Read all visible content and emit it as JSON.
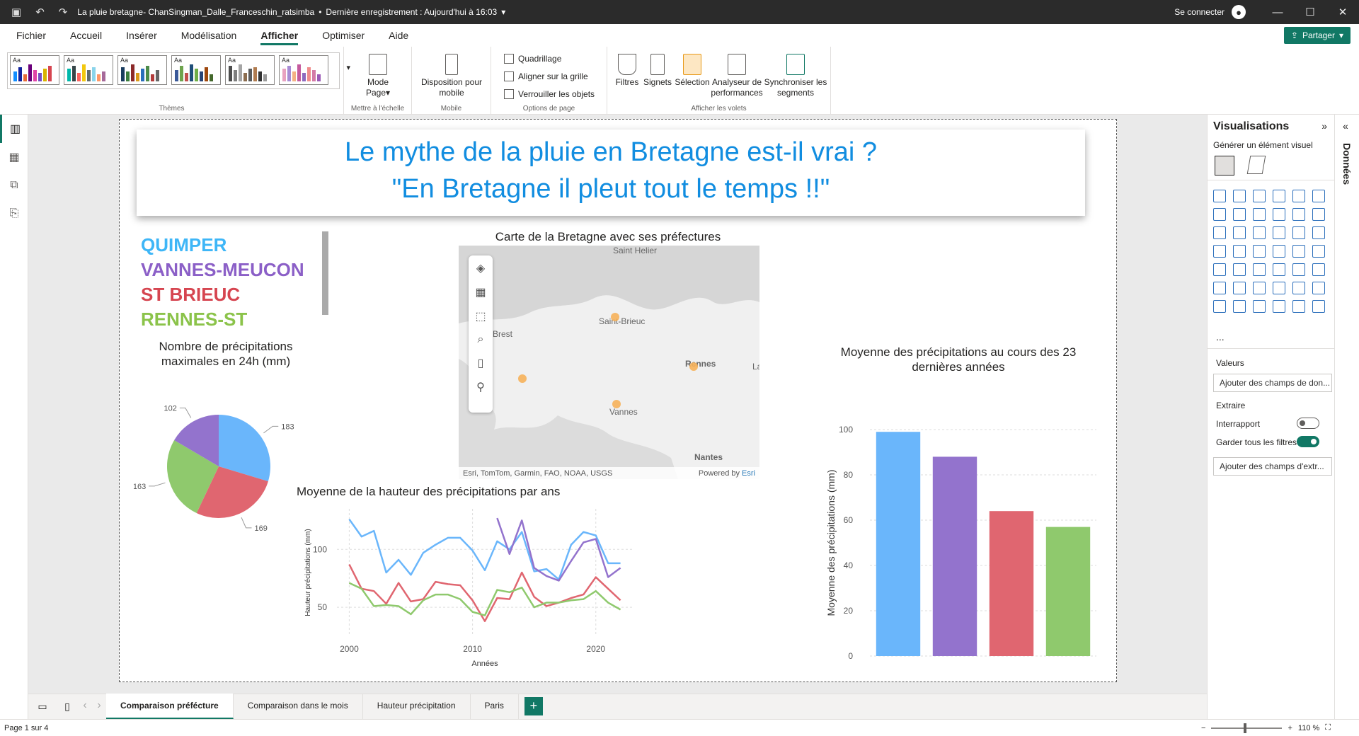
{
  "titlebar": {
    "title": "La pluie bretagne- ChanSingman_Dalle_Franceschin_ratsimba",
    "saved": "Dernière enregistrement : Aujourd'hui à 16:03",
    "signin": "Se connecter"
  },
  "menu": [
    "Fichier",
    "Accueil",
    "Insérer",
    "Modélisation",
    "Afficher",
    "Optimiser",
    "Aide"
  ],
  "share": "Partager",
  "ribbon": {
    "themes_label": "Thèmes",
    "theme_aa": "Aa",
    "mode_page": "Mode",
    "mode_page2": "Page",
    "scale_label": "Mettre à l'échelle",
    "mobile_btn": "Disposition pour",
    "mobile_btn2": "mobile",
    "mobile_label": "Mobile",
    "grid": "Quadrillage",
    "snap": "Aligner sur la grille",
    "lock": "Verrouiller les objets",
    "page_opts_label": "Options de page",
    "filters": "Filtres",
    "bookmarks": "Signets",
    "selection": "Sélection",
    "perf": "Analyseur de",
    "perf2": "performances",
    "sync": "Synchroniser les",
    "sync2": "segments",
    "panes_label": "Afficher les volets"
  },
  "report": {
    "title_line1": "Le mythe de la pluie en Bretagne est-il vrai ?",
    "title_line2": "\"En Bretagne il pleut tout le temps !!\"",
    "stations": [
      {
        "name": "QUIMPER",
        "color": "#3eb6f7"
      },
      {
        "name": "VANNES-MEUCON",
        "color": "#8b5fc7"
      },
      {
        "name": "ST BRIEUC",
        "color": "#d64550"
      },
      {
        "name": "RENNES-ST",
        "color": "#8bc34a"
      }
    ],
    "pie_title": "Nombre de précipitations maximales en 24h (mm)",
    "map_title": "Carte de la Bretagne avec ses préfectures",
    "map_labels": [
      "Saint Helier",
      "Saint-Brieuc",
      "Rennes",
      "Vannes",
      "Nantes",
      "Brest",
      "La"
    ],
    "map_attr": "Esri, TomTom, Garmin, FAO, NOAA, USGS",
    "map_powered": "Powered by",
    "map_esri": "Esri",
    "line_title": "Moyenne de la hauteur des précipitations par ans",
    "bar_title": "Moyenne des précipitations au cours des 23 dernières années"
  },
  "chart_data": [
    {
      "type": "pie",
      "title": "Nombre de précipitations maximales en 24h (mm)",
      "values": [
        183,
        169,
        163,
        102
      ],
      "colors": [
        "#6ab6fb",
        "#e06670",
        "#8fc96d",
        "#9373cd"
      ]
    },
    {
      "type": "line",
      "title": "Moyenne de la hauteur des précipitations par ans",
      "xlabel": "Années",
      "ylabel": "Hauteur précipitations (mm)",
      "x_ticks": [
        2000,
        2010,
        2020
      ],
      "y_ticks": [
        50,
        100
      ],
      "x": [
        2000,
        2001,
        2002,
        2003,
        2004,
        2005,
        2006,
        2007,
        2008,
        2009,
        2010,
        2011,
        2012,
        2013,
        2014,
        2015,
        2016,
        2017,
        2018,
        2019,
        2020,
        2021,
        2022
      ],
      "series": [
        {
          "color": "#6ab6fb",
          "values": [
            126,
            111,
            116,
            80,
            91,
            78,
            97,
            104,
            110,
            110,
            99,
            82,
            107,
            100,
            115,
            81,
            83,
            74,
            104,
            115,
            112,
            88,
            88
          ]
        },
        {
          "color": "#9373cd",
          "values": [
            null,
            null,
            null,
            null,
            null,
            null,
            null,
            null,
            null,
            null,
            null,
            null,
            127,
            96,
            125,
            84,
            77,
            73,
            90,
            106,
            109,
            76,
            84
          ]
        },
        {
          "color": "#e06670",
          "values": [
            87,
            66,
            64,
            53,
            71,
            55,
            57,
            72,
            70,
            69,
            56,
            38,
            58,
            57,
            80,
            59,
            51,
            54,
            58,
            61,
            76,
            66,
            56
          ]
        },
        {
          "color": "#8fc96d",
          "values": [
            71,
            66,
            51,
            52,
            51,
            44,
            56,
            61,
            61,
            57,
            46,
            43,
            65,
            63,
            67,
            50,
            54,
            54,
            56,
            57,
            64,
            54,
            48
          ]
        }
      ]
    },
    {
      "type": "bar",
      "title": "Moyenne des précipitations au cours des 23 dernières années",
      "ylabel": "Moyenne des précipitations (mm)",
      "ylim": [
        0,
        100
      ],
      "y_ticks": [
        0,
        20,
        40,
        60,
        80,
        100
      ],
      "values": [
        99,
        88,
        64,
        57
      ],
      "colors": [
        "#6ab6fb",
        "#9373cd",
        "#e06670",
        "#8fc96d"
      ]
    }
  ],
  "rightpane": {
    "title": "Visualisations",
    "build": "Générer un élément visuel",
    "values": "Valeurs",
    "add_fields": "Ajouter des champs de don...",
    "extract": "Extraire",
    "cross": "Interrapport",
    "keep": "Garder tous les filtres",
    "add_extract": "Ajouter des champs d'extr...",
    "donnees": "Données",
    "more": "..."
  },
  "tabs": [
    "Comparaison préfécture",
    "Comparaison dans le mois",
    "Hauteur précipitation",
    "Paris"
  ],
  "status": {
    "page": "Page 1 sur 4",
    "zoom": "110 %"
  }
}
